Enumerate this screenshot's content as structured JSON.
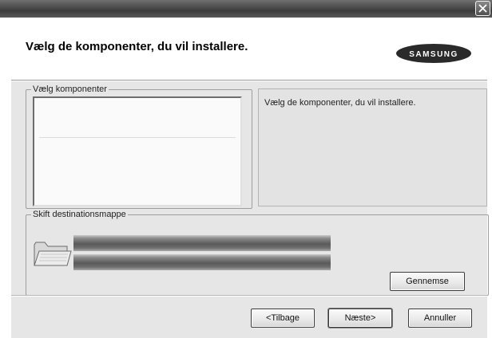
{
  "window": {
    "close_icon": "close-icon"
  },
  "header": {
    "title": "Vælg de komponenter, du vil installere.",
    "brand": "SAMSUNG"
  },
  "components_group": {
    "legend": "Vælg komponenter"
  },
  "description": {
    "text": "Vælg de komponenter, du vil installere."
  },
  "destination_group": {
    "legend": "Skift destinationsmappe",
    "browse_label": "Gennemse"
  },
  "footer": {
    "back_label": "<Tilbage",
    "next_label": "Næste>",
    "cancel_label": "Annuller"
  }
}
